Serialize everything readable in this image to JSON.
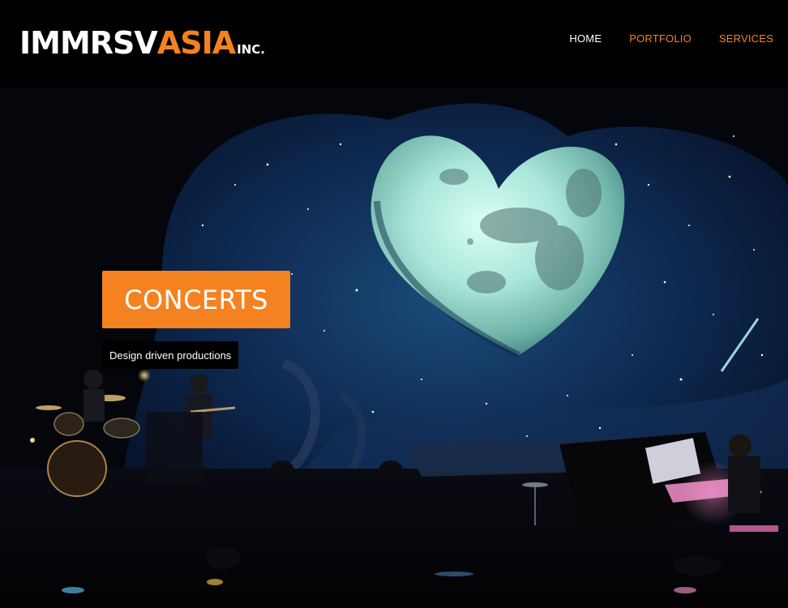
{
  "logo": {
    "main": "IMMRSV",
    "accent": "ASIA",
    "suffix": "INC."
  },
  "nav": {
    "items": [
      {
        "label": "HOME",
        "color": "#ffffff"
      },
      {
        "label": "PORTFOLIO",
        "color": "#f58220"
      },
      {
        "label": "SERVICES",
        "color": "#f58220"
      }
    ]
  },
  "hero": {
    "button_label": "CONCERTS",
    "tagline": "Design driven productions"
  },
  "colors": {
    "accent": "#f58220",
    "header_bg": "#000000"
  }
}
